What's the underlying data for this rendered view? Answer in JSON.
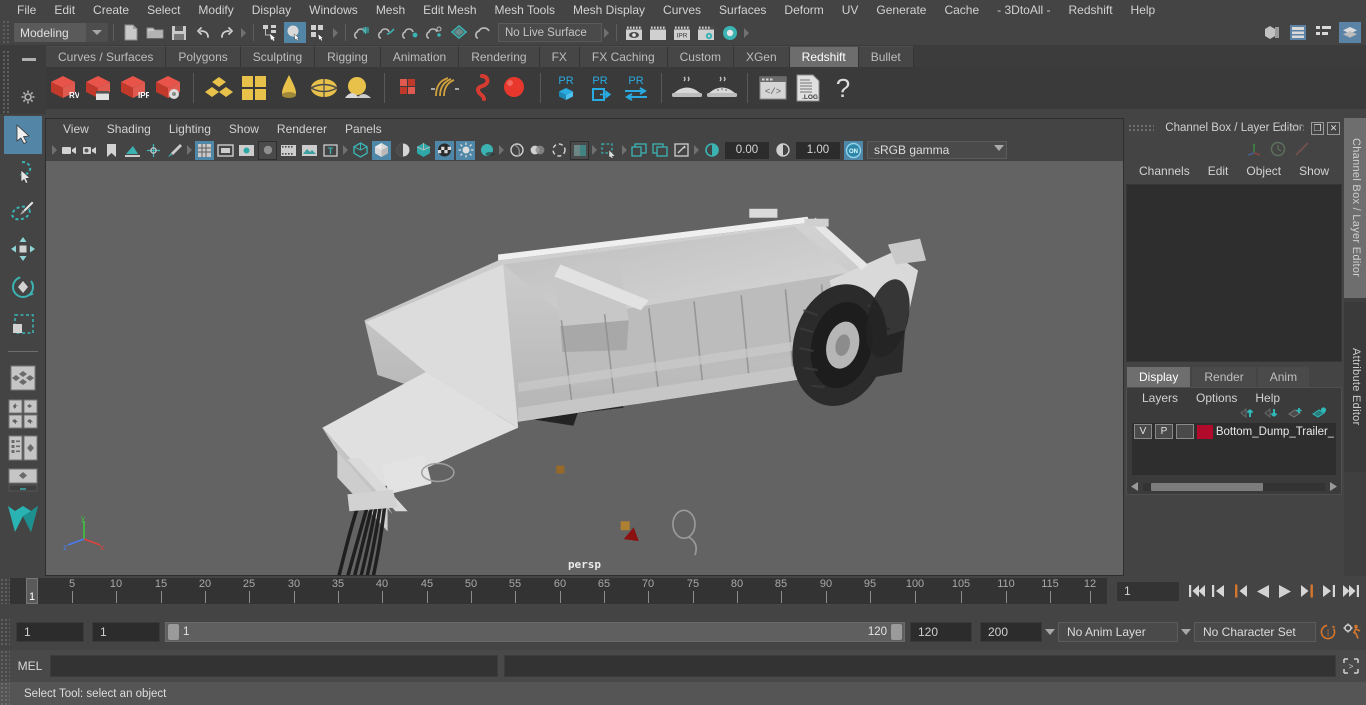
{
  "menubar": {
    "items": [
      "File",
      "Edit",
      "Create",
      "Select",
      "Modify",
      "Display",
      "Windows",
      "Mesh",
      "Edit Mesh",
      "Mesh Tools",
      "Mesh Display",
      "Curves",
      "Surfaces",
      "Deform",
      "UV",
      "Generate",
      "Cache",
      "- 3DtoAll -",
      "Redshift",
      "Help"
    ]
  },
  "statusline": {
    "menuset": "Modeling",
    "live_surface": "No Live Surface",
    "icons": [
      "new-scene-icon",
      "open-scene-icon",
      "save-scene-icon",
      "undo-icon",
      "redo-icon",
      "select-by-hierarchy-icon",
      "select-by-object-icon",
      "select-by-component-icon",
      "snap-to-grid-icon",
      "snap-to-curve-icon",
      "snap-to-point-icon",
      "snap-to-projected-center-icon",
      "snap-to-view-plane-icon",
      "make-live-icon",
      "render-view-icon",
      "render-current-frame-icon",
      "ipr-render-icon",
      "render-settings-icon",
      "toggle-icon"
    ],
    "right_icons": [
      "modeling-toolkit-icon",
      "attribute-editor-icon",
      "tool-settings-icon",
      "channel-box-icon"
    ]
  },
  "shelf": {
    "tabs": [
      "Curves / Surfaces",
      "Polygons",
      "Sculpting",
      "Rigging",
      "Animation",
      "Rendering",
      "FX",
      "FX Caching",
      "Custom",
      "XGen",
      "Redshift",
      "Bullet"
    ],
    "active_tab": "Redshift",
    "buttons": [
      {
        "name": "redshift-render-view",
        "label": "RV"
      },
      {
        "name": "redshift-render-sequence",
        "label": ""
      },
      {
        "name": "redshift-ipr",
        "label": "IPR"
      },
      {
        "name": "redshift-render-settings",
        "label": ""
      },
      {
        "name": "redshift-material-icon",
        "label": ""
      },
      {
        "name": "redshift-grid-icon",
        "label": ""
      },
      {
        "name": "redshift-cone-light-icon",
        "label": ""
      },
      {
        "name": "redshift-dome-light-icon",
        "label": ""
      },
      {
        "name": "redshift-environment-icon",
        "label": ""
      },
      {
        "name": "redshift-proxy-icon",
        "label": ""
      },
      {
        "name": "redshift-hair-icon",
        "label": ""
      },
      {
        "name": "redshift-volume-icon",
        "label": ""
      },
      {
        "name": "redshift-sphere-icon",
        "label": ""
      },
      {
        "name": "redshift-pr-cube-icon",
        "label": "PR"
      },
      {
        "name": "redshift-pr-export-icon",
        "label": "PR"
      },
      {
        "name": "redshift-pr-transfer-icon",
        "label": "PR"
      },
      {
        "name": "redshift-bake-icon",
        "label": ""
      },
      {
        "name": "redshift-bake-all-icon",
        "label": ""
      },
      {
        "name": "redshift-script-icon",
        "label": ""
      },
      {
        "name": "redshift-log-icon",
        "label": ".LOG"
      },
      {
        "name": "redshift-help-icon",
        "label": "?"
      }
    ]
  },
  "toolbox": {
    "items": [
      {
        "name": "select-tool",
        "active": true
      },
      {
        "name": "lasso-select-tool",
        "active": false
      },
      {
        "name": "paint-select-tool",
        "active": false
      },
      {
        "name": "move-tool",
        "active": false
      },
      {
        "name": "rotate-tool",
        "active": false
      },
      {
        "name": "scale-tool",
        "active": false
      },
      {
        "name": "last-tool-used",
        "active": false
      },
      {
        "name": "four-view-layout",
        "active": false
      },
      {
        "name": "persp-outliner-layout",
        "active": false
      },
      {
        "name": "persp-graph-layout",
        "active": false
      },
      {
        "name": "single-persp-layout",
        "active": false
      },
      {
        "name": "maya-logo-icon",
        "active": false
      }
    ]
  },
  "viewport": {
    "menus": [
      "View",
      "Shading",
      "Lighting",
      "Show",
      "Renderer",
      "Panels"
    ],
    "camera_label": "persp",
    "exposure": "0.00",
    "gamma": "1.00",
    "color_management": "sRGB gamma",
    "background_color": "#636363",
    "icons": [
      "select-camera-icon",
      "camera-attributes-icon",
      "bookmark-icon",
      "image-plane-icon",
      "2d-pan-zoom-icon",
      "grease-pencil-icon",
      "grid-toggle-icon",
      "film-gate-icon",
      "resolution-gate-icon",
      "gate-mask-icon",
      "film-origin-icon",
      "safe-action-icon",
      "text-overlay-icon",
      "wireframe-icon",
      "smooth-shade-icon",
      "flat-shade-icon",
      "shaded-wireframe-icon",
      "textured-icon",
      "lighting-icon",
      "shadows-icon",
      "ao-icon",
      "motion-blur-icon",
      "xray-icon",
      "xray-joints-icon",
      "xray-active-icon",
      "isolate-select-icon",
      "image-based-lighting-icon",
      "display-layers-icon",
      "viewport-snapshot-icon",
      "exposure-icon",
      "gamma-icon",
      "color-management-toggle-icon"
    ]
  },
  "channel_box": {
    "panel_title": "Channel Box / Layer Editor",
    "menus": [
      "Channels",
      "Edit",
      "Object",
      "Show"
    ],
    "window_buttons": [
      "restore-icon",
      "close-icon"
    ],
    "header_icons": [
      "axis-display-icon",
      "clock-icon",
      "slope-icon"
    ],
    "content": ""
  },
  "layer_editor": {
    "tabs": [
      "Display",
      "Render",
      "Anim"
    ],
    "active_tab": "Display",
    "menus": [
      "Layers",
      "Options",
      "Help"
    ],
    "buttons": [
      "move-layer-up-icon",
      "move-layer-down-icon",
      "new-layer-icon",
      "new-layer-from-selected-icon"
    ],
    "layers": [
      {
        "visibility": "V",
        "playback": "P",
        "shading": "",
        "color": "#b20a2b",
        "name": "Bottom_Dump_Trailer_"
      }
    ]
  },
  "side_tabs": [
    {
      "label": "Channel Box / Layer Editor",
      "active": true
    },
    {
      "label": "Attribute Editor",
      "active": false
    }
  ],
  "timeline": {
    "start": 1,
    "end": 120,
    "current_frame": "1",
    "tick_labels": [
      "5",
      "10",
      "15",
      "20",
      "25",
      "30",
      "35",
      "40",
      "45",
      "50",
      "55",
      "60",
      "65",
      "70",
      "75",
      "80",
      "85",
      "90",
      "95",
      "100",
      "105",
      "110",
      "115",
      "12"
    ],
    "current_frame_field": "1",
    "playback_buttons": [
      "go-to-start-icon",
      "step-back-keyframe-icon",
      "step-back-frame-icon",
      "play-backwards-icon",
      "play-forwards-icon",
      "step-forward-frame-icon",
      "step-forward-keyframe-icon",
      "go-to-end-icon"
    ]
  },
  "range_slider": {
    "anim_start": "1",
    "playback_start": "1",
    "range_low_label": "1",
    "range_high_label": "120",
    "playback_end": "120",
    "anim_end": "200",
    "anim_layer": "No Anim Layer",
    "character_set": "No Character Set",
    "right_icons": [
      "auto-keyframe-icon",
      "animation-preferences-icon"
    ]
  },
  "command_line": {
    "language": "MEL",
    "input_value": "",
    "output_value": "",
    "script_editor_icon": "script-editor-icon"
  },
  "help_line": {
    "text": "Select Tool: select an object"
  },
  "colors": {
    "accent_blue": "#5285a6",
    "teal": "#3bb3b3",
    "redshift_red": "#d63b31",
    "shelf_yellow": "#e8b838",
    "orange": "#d1762f",
    "layer_red": "#b20a2b"
  }
}
